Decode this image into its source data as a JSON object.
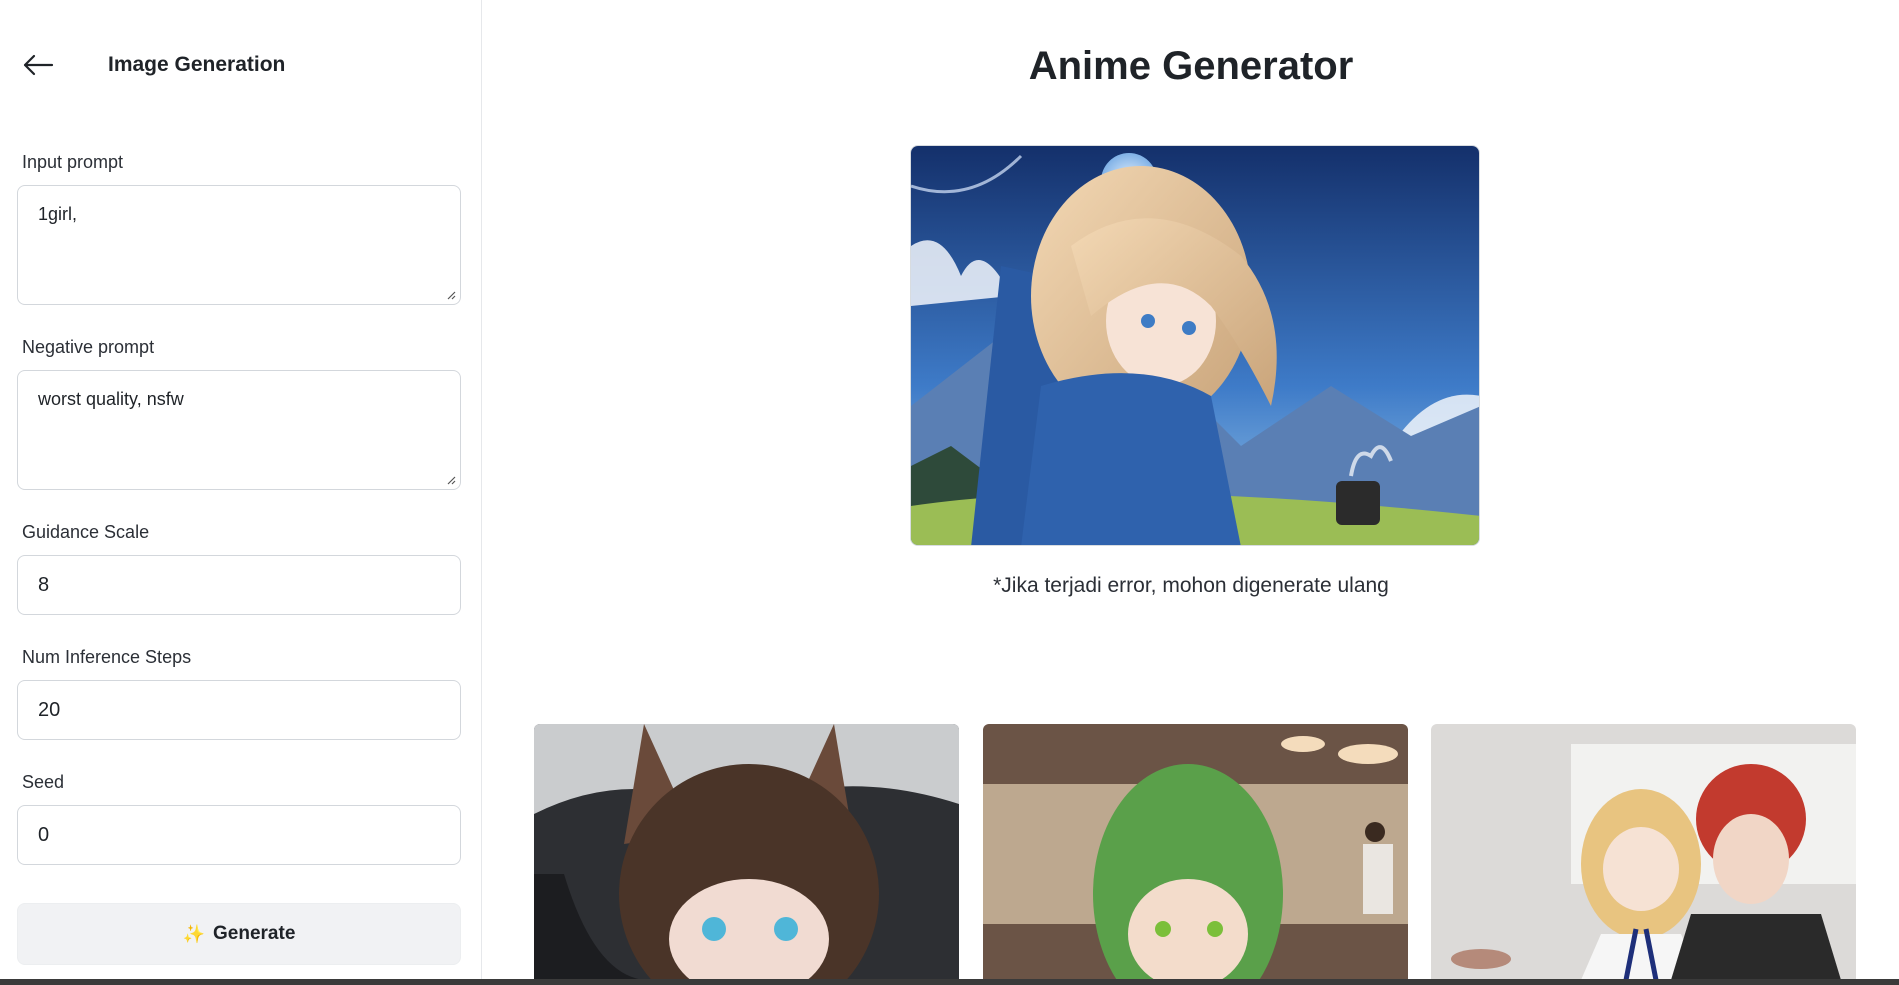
{
  "sidebar": {
    "title": "Image Generation",
    "back_icon": "arrow-left-icon",
    "fields": {
      "input_prompt": {
        "label": "Input prompt",
        "value": "1girl,"
      },
      "negative_prompt": {
        "label": "Negative prompt",
        "value": "worst quality, nsfw"
      },
      "guidance_scale": {
        "label": "Guidance Scale",
        "value": "8"
      },
      "num_inference_steps": {
        "label": "Num Inference Steps",
        "value": "20"
      },
      "seed": {
        "label": "Seed",
        "value": "0"
      }
    },
    "generate_button": {
      "icon": "sparkles-icon",
      "label": "Generate"
    }
  },
  "main": {
    "title": "Anime Generator",
    "note": "*Jika terjadi error, mohon digenerate ulang"
  },
  "colors": {
    "border": "#d3d7dc",
    "button_bg": "#f1f2f4",
    "text": "#1f2328"
  }
}
